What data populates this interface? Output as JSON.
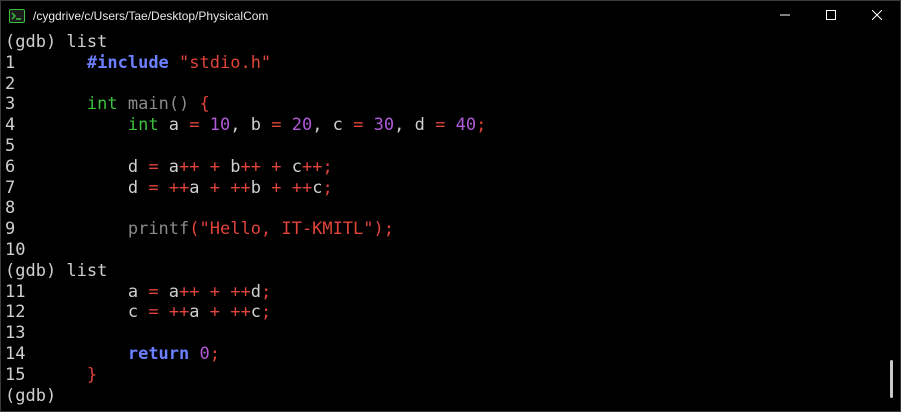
{
  "window": {
    "title": "/cygdrive/c/Users/Tae/Desktop/PhysicalCom",
    "icon": "terminal-icon"
  },
  "controls": {
    "minimize_icon": "minimize-icon",
    "maximize_icon": "maximize-icon",
    "close_icon": "close-icon"
  },
  "colors": {
    "background": "#000000",
    "text": "#cfcfcf",
    "preprocessor": "#6b7fff",
    "string": "#e0443a",
    "type": "#3cc13c",
    "function": "#8a8a8a",
    "operator": "#e0443a",
    "literal": "#b05ad8"
  },
  "terminal": {
    "lines": [
      [
        {
          "t": "(gdb) list",
          "c": "prompt"
        }
      ],
      [
        {
          "t": "1",
          "c": "num"
        },
        {
          "t": "       ",
          "c": "id"
        },
        {
          "t": "#include",
          "c": "pre"
        },
        {
          "t": " ",
          "c": "id"
        },
        {
          "t": "\"stdio.h\"",
          "c": "str"
        }
      ],
      [
        {
          "t": "2",
          "c": "num"
        }
      ],
      [
        {
          "t": "3",
          "c": "num"
        },
        {
          "t": "       ",
          "c": "id"
        },
        {
          "t": "int",
          "c": "type"
        },
        {
          "t": " ",
          "c": "id"
        },
        {
          "t": "main() ",
          "c": "fn"
        },
        {
          "t": "{",
          "c": "op"
        }
      ],
      [
        {
          "t": "4",
          "c": "num"
        },
        {
          "t": "           ",
          "c": "id"
        },
        {
          "t": "int",
          "c": "type"
        },
        {
          "t": " a ",
          "c": "id"
        },
        {
          "t": "=",
          "c": "op"
        },
        {
          "t": " ",
          "c": "id"
        },
        {
          "t": "10",
          "c": "lit"
        },
        {
          "t": ", b ",
          "c": "id"
        },
        {
          "t": "=",
          "c": "op"
        },
        {
          "t": " ",
          "c": "id"
        },
        {
          "t": "20",
          "c": "lit"
        },
        {
          "t": ", c ",
          "c": "id"
        },
        {
          "t": "=",
          "c": "op"
        },
        {
          "t": " ",
          "c": "id"
        },
        {
          "t": "30",
          "c": "lit"
        },
        {
          "t": ", d ",
          "c": "id"
        },
        {
          "t": "=",
          "c": "op"
        },
        {
          "t": " ",
          "c": "id"
        },
        {
          "t": "40",
          "c": "lit"
        },
        {
          "t": ";",
          "c": "op"
        }
      ],
      [
        {
          "t": "5",
          "c": "num"
        }
      ],
      [
        {
          "t": "6",
          "c": "num"
        },
        {
          "t": "           d ",
          "c": "id"
        },
        {
          "t": "=",
          "c": "op"
        },
        {
          "t": " a",
          "c": "id"
        },
        {
          "t": "++",
          "c": "op"
        },
        {
          "t": " ",
          "c": "id"
        },
        {
          "t": "+",
          "c": "op"
        },
        {
          "t": " b",
          "c": "id"
        },
        {
          "t": "++",
          "c": "op"
        },
        {
          "t": " ",
          "c": "id"
        },
        {
          "t": "+",
          "c": "op"
        },
        {
          "t": " c",
          "c": "id"
        },
        {
          "t": "++;",
          "c": "op"
        }
      ],
      [
        {
          "t": "7",
          "c": "num"
        },
        {
          "t": "           d ",
          "c": "id"
        },
        {
          "t": "=",
          "c": "op"
        },
        {
          "t": " ",
          "c": "id"
        },
        {
          "t": "++",
          "c": "op"
        },
        {
          "t": "a ",
          "c": "id"
        },
        {
          "t": "+",
          "c": "op"
        },
        {
          "t": " ",
          "c": "id"
        },
        {
          "t": "++",
          "c": "op"
        },
        {
          "t": "b ",
          "c": "id"
        },
        {
          "t": "+",
          "c": "op"
        },
        {
          "t": " ",
          "c": "id"
        },
        {
          "t": "++",
          "c": "op"
        },
        {
          "t": "c",
          "c": "id"
        },
        {
          "t": ";",
          "c": "op"
        }
      ],
      [
        {
          "t": "8",
          "c": "num"
        }
      ],
      [
        {
          "t": "9",
          "c": "num"
        },
        {
          "t": "           ",
          "c": "id"
        },
        {
          "t": "printf",
          "c": "fn"
        },
        {
          "t": "(",
          "c": "op"
        },
        {
          "t": "\"Hello, IT-KMITL\"",
          "c": "str"
        },
        {
          "t": ");",
          "c": "op"
        }
      ],
      [
        {
          "t": "10",
          "c": "num"
        }
      ],
      [
        {
          "t": "(gdb) list",
          "c": "prompt"
        }
      ],
      [
        {
          "t": "11",
          "c": "num"
        },
        {
          "t": "          a ",
          "c": "id"
        },
        {
          "t": "=",
          "c": "op"
        },
        {
          "t": " a",
          "c": "id"
        },
        {
          "t": "++",
          "c": "op"
        },
        {
          "t": " ",
          "c": "id"
        },
        {
          "t": "+",
          "c": "op"
        },
        {
          "t": " ",
          "c": "id"
        },
        {
          "t": "++",
          "c": "op"
        },
        {
          "t": "d",
          "c": "id"
        },
        {
          "t": ";",
          "c": "op"
        }
      ],
      [
        {
          "t": "12",
          "c": "num"
        },
        {
          "t": "          c ",
          "c": "id"
        },
        {
          "t": "=",
          "c": "op"
        },
        {
          "t": " ",
          "c": "id"
        },
        {
          "t": "++",
          "c": "op"
        },
        {
          "t": "a ",
          "c": "id"
        },
        {
          "t": "+",
          "c": "op"
        },
        {
          "t": " ",
          "c": "id"
        },
        {
          "t": "++",
          "c": "op"
        },
        {
          "t": "c",
          "c": "id"
        },
        {
          "t": ";",
          "c": "op"
        }
      ],
      [
        {
          "t": "13",
          "c": "num"
        }
      ],
      [
        {
          "t": "14",
          "c": "num"
        },
        {
          "t": "          ",
          "c": "id"
        },
        {
          "t": "return",
          "c": "kw"
        },
        {
          "t": " ",
          "c": "id"
        },
        {
          "t": "0",
          "c": "lit"
        },
        {
          "t": ";",
          "c": "op"
        }
      ],
      [
        {
          "t": "15",
          "c": "num"
        },
        {
          "t": "      ",
          "c": "id"
        },
        {
          "t": "}",
          "c": "op"
        }
      ],
      [
        {
          "t": "(gdb)",
          "c": "prompt"
        }
      ]
    ]
  }
}
